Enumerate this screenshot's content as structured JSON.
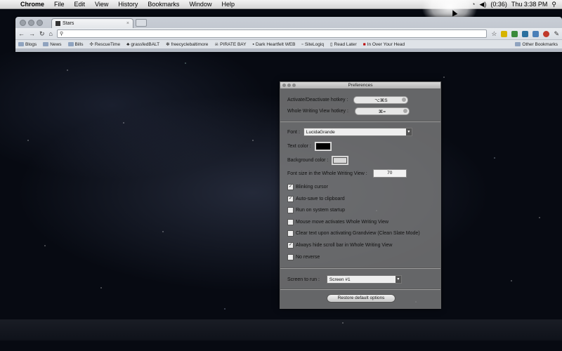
{
  "menubar": {
    "app_name": "Chrome",
    "menus": [
      "File",
      "Edit",
      "View",
      "History",
      "Bookmarks",
      "Window",
      "Help"
    ],
    "battery": "(0:36)",
    "clock": "Thu 3:38 PM"
  },
  "browser": {
    "tab_title": "Stars",
    "tab_close": "×",
    "bookmarks": [
      {
        "label": "Blogs",
        "icon": "folder-icon"
      },
      {
        "label": "News",
        "icon": "folder-icon"
      },
      {
        "label": "Bills",
        "icon": "folder-icon"
      },
      {
        "label": "RescueTime",
        "icon": "rescuetime-icon"
      },
      {
        "label": "grassfedBALT",
        "icon": "site-icon"
      },
      {
        "label": "freecyclebaltimore",
        "icon": "site-icon"
      },
      {
        "label": "PIRATE BAY",
        "icon": "site-icon"
      },
      {
        "label": "Dark Heartfelt WEB",
        "icon": "site-icon"
      },
      {
        "label": "SiteLogiq",
        "icon": "site-icon"
      },
      {
        "label": "Read Later",
        "icon": "page-icon"
      },
      {
        "label": "In Over Your Head",
        "icon": "site-icon"
      }
    ],
    "other_bookmarks": "Other Bookmarks"
  },
  "preferences": {
    "title": "Preferences",
    "activate_label": "Activate/Deactivate hotkey :",
    "activate_value": "⌥⌘S",
    "whole_view_label": "Whole Writing View hotkey :",
    "whole_view_value": "⌘=",
    "font_label": "Font :",
    "font_value": "LucidaGrande",
    "text_color_label": "Text color :",
    "text_color": "#000000",
    "bg_color_label": "Background color :",
    "bg_color": "#d8d8d8",
    "font_size_label": "Font size in the Whole Writing View :",
    "font_size_value": "70",
    "checkbox_mark": "✓",
    "options": [
      {
        "label": "Blinking cursor",
        "checked": true
      },
      {
        "label": "Auto-save to clipboard",
        "checked": true
      },
      {
        "label": "Run on system startup",
        "checked": false
      },
      {
        "label": "Mouse move activates Whole Writing View",
        "checked": false
      },
      {
        "label": "Clear text upon activating Grandview (Clean Slate Mode)",
        "checked": false
      },
      {
        "label": "Always hide scroll bar in Whole Writing View",
        "checked": true
      },
      {
        "label": "No reverse",
        "checked": false
      }
    ],
    "screen_label": "Screen to run :",
    "screen_value": "Screen #1",
    "restore_button": "Restore default options"
  }
}
